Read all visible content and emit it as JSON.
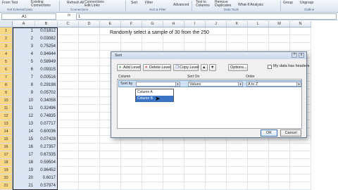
{
  "ribbon": {
    "items": [
      "From Text",
      "Existing Connections",
      "Refresh All",
      "Connections",
      "Properties",
      "Edit Links",
      "Sort",
      "Filter",
      "Clear",
      "Reapply",
      "Advanced",
      "Text to Columns",
      "Remove Duplicates",
      "Data Validation",
      "Consolidate",
      "What-If Analysis",
      "Group",
      "Ungroup",
      "Subtotal"
    ],
    "groups": [
      "Get External Data",
      "Connections",
      "Sort & Filter",
      "Data Tools",
      "Outline"
    ]
  },
  "formula_bar": {
    "name_box": "A1",
    "fx": "fx",
    "value": "1"
  },
  "columns": [
    "A",
    "B",
    "C",
    "D",
    "E",
    "F",
    "G",
    "H",
    "I",
    "J",
    "K",
    "L",
    "M",
    "N"
  ],
  "rows": [
    {
      "n": "1",
      "a": "1",
      "b": "0.01812"
    },
    {
      "n": "2",
      "a": "2",
      "b": "0.03082"
    },
    {
      "n": "3",
      "a": "3",
      "b": "0.75254"
    },
    {
      "n": "4",
      "a": "4",
      "b": "0.94644"
    },
    {
      "n": "5",
      "a": "5",
      "b": "0.58949"
    },
    {
      "n": "6",
      "a": "6",
      "b": "0.09315"
    },
    {
      "n": "7",
      "a": "7",
      "b": "0.00516"
    },
    {
      "n": "8",
      "a": "8",
      "b": "0.29198"
    },
    {
      "n": "9",
      "a": "9",
      "b": "0.05702"
    },
    {
      "n": "10",
      "a": "10",
      "b": "0.34058"
    },
    {
      "n": "11",
      "a": "11",
      "b": "0.32496"
    },
    {
      "n": "12",
      "a": "12",
      "b": "0.74835"
    },
    {
      "n": "13",
      "a": "13",
      "b": "0.07717"
    },
    {
      "n": "14",
      "a": "14",
      "b": "0.60036"
    },
    {
      "n": "15",
      "a": "15",
      "b": "0.07428"
    },
    {
      "n": "16",
      "a": "16",
      "b": "0.27357"
    },
    {
      "n": "17",
      "a": "17",
      "b": "0.67335"
    },
    {
      "n": "18",
      "a": "18",
      "b": "0.59504"
    },
    {
      "n": "19",
      "a": "19",
      "b": "0.96452"
    },
    {
      "n": "20",
      "a": "20",
      "b": "0.6017"
    },
    {
      "n": "21",
      "a": "21",
      "b": "0.57974"
    }
  ],
  "note": "Randomly select a sample of 30 from the 250",
  "dialog": {
    "title": "Sort",
    "help": "?",
    "close": "x",
    "add_level": "Add Level",
    "delete_level": "Delete Level",
    "copy_level": "Copy Level",
    "options": "Options...",
    "headers_label": "My data has headers",
    "col_header": "Column",
    "sorton_header": "Sort On",
    "order_header": "Order",
    "row_label": "Sort by",
    "sort_on_value": "Values",
    "order_value": "A to Z",
    "dropdown": [
      "Column A",
      "Column B"
    ],
    "ok": "OK",
    "cancel": "Cancel"
  }
}
